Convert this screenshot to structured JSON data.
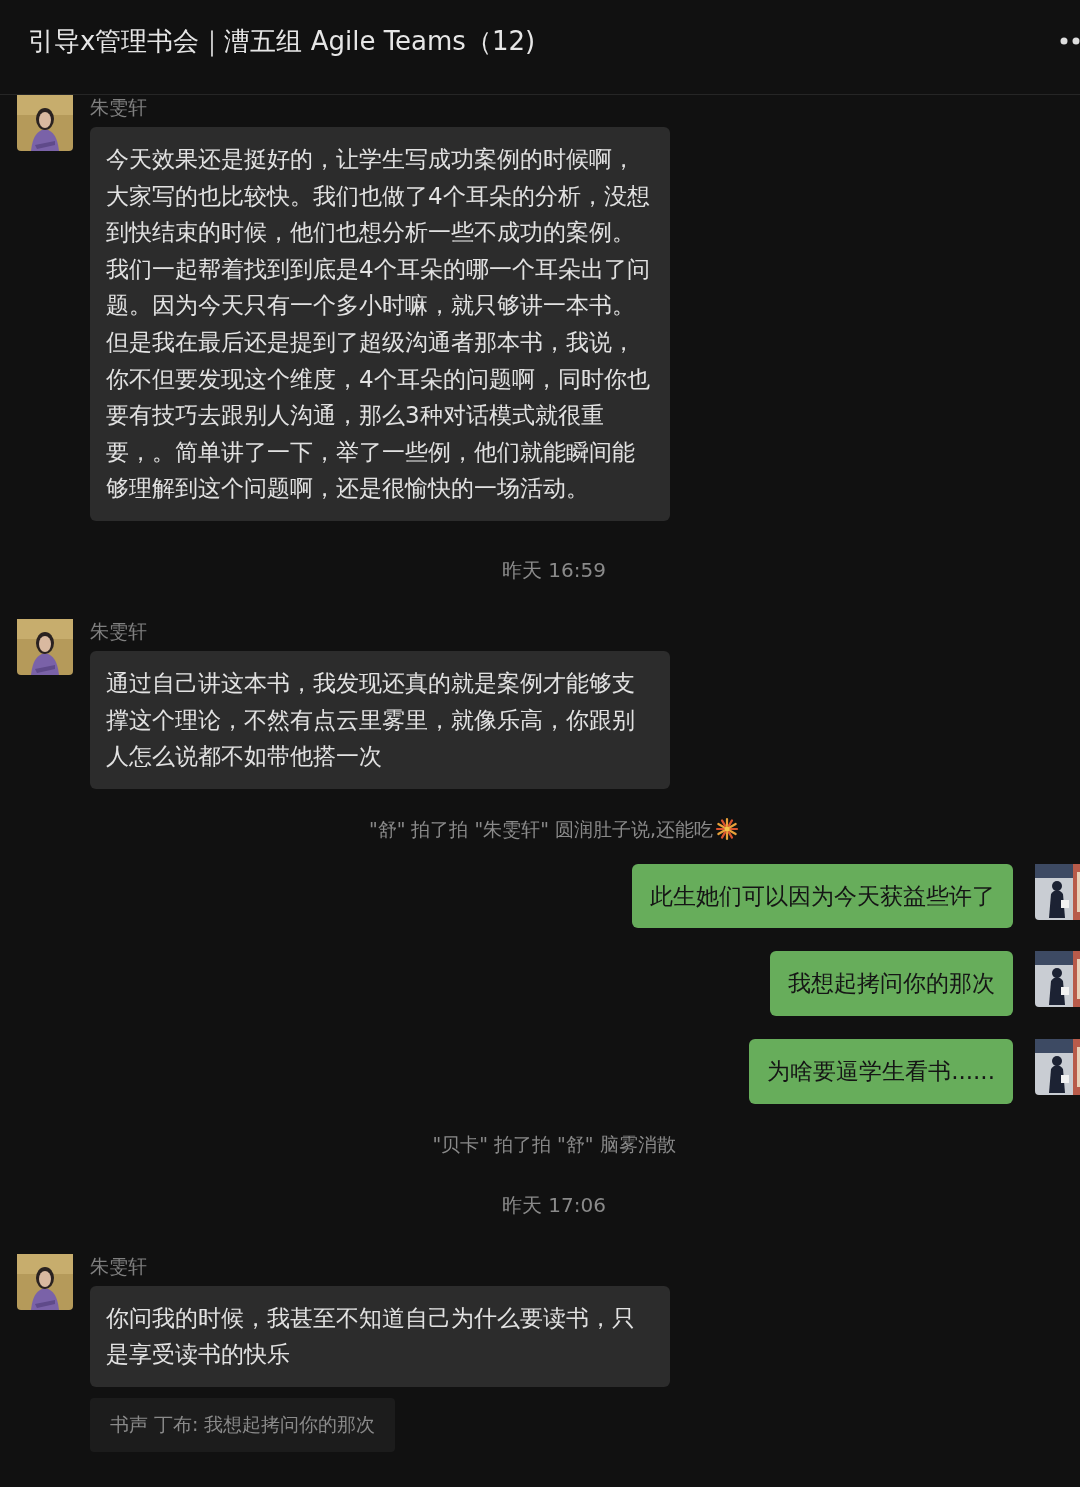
{
  "window": {
    "title": "引导x管理书会｜漕五组 Agile Teams（12)"
  },
  "messages": [
    {
      "kind": "incoming",
      "sender": "朱雯轩",
      "text": "今天效果还是挺好的，让学生写成功案例的时候啊，大家写的也比较快。我们也做了4个耳朵的分析，没想到快结束的时候，他们也想分析一些不成功的案例。我们一起帮着找到到底是4个耳朵的哪一个耳朵出了问题。因为今天只有一个多小时嘛，就只够讲一本书。但是我在最后还是提到了超级沟通者那本书，我说，你不但要发现这个维度，4个耳朵的问题啊，同时你也要有技巧去跟别人沟通，那么3种对话模式就很重要，。简单讲了一下，举了一些例，他们就能瞬间能够理解到这个问题啊，还是很愉快的一场活动。"
    },
    {
      "kind": "time",
      "text": "昨天 16:59"
    },
    {
      "kind": "incoming",
      "sender": "朱雯轩",
      "text": "通过自己讲这本书，我发现还真的就是案例才能够支撑这个理论，不然有点云里雾里，就像乐高，你跟别人怎么说都不如带他搭一次"
    },
    {
      "kind": "system",
      "text": "\"舒\" 拍了拍 \"朱雯轩\" 圆润肚子说,还能吃"
    },
    {
      "kind": "outgoing",
      "text": "此生她们可以因为今天获益些许了"
    },
    {
      "kind": "outgoing",
      "text": "我想起拷问你的那次"
    },
    {
      "kind": "outgoing",
      "text": "为啥要逼学生看书......"
    },
    {
      "kind": "system",
      "text": "\"贝卡\" 拍了拍 \"舒\" 脑雾消散"
    },
    {
      "kind": "time",
      "text": "昨天 17:06"
    },
    {
      "kind": "incoming",
      "sender": "朱雯轩",
      "text": "你问我的时候，我甚至不知道自己为什么要读书，只是享受读书的快乐",
      "quote": "书声 丁布: 我想起拷问你的那次"
    }
  ]
}
